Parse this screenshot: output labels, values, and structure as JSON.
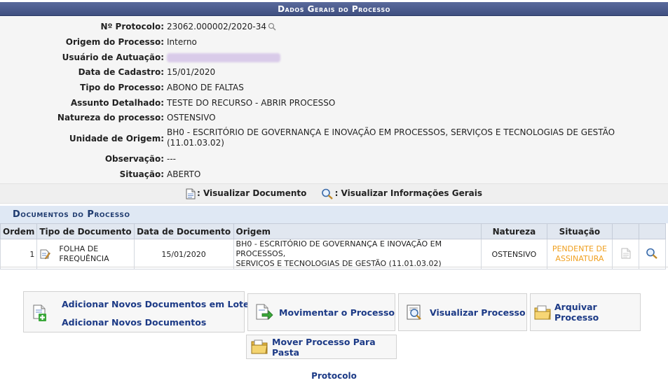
{
  "header": {
    "title": "Dados Gerais do Processo"
  },
  "general": [
    {
      "label": "Nº Protocolo:",
      "value": "23062.000002/2020-34"
    },
    {
      "label": "Origem do Processo:",
      "value": "Interno"
    },
    {
      "label": "Usuário de Autuação:",
      "value": ""
    },
    {
      "label": "Data de Cadastro:",
      "value": "15/01/2020"
    },
    {
      "label": "Tipo do Processo:",
      "value": "ABONO DE FALTAS"
    },
    {
      "label": "Assunto Detalhado:",
      "value": "TESTE DO RECURSO - ABRIR PROCESSO"
    },
    {
      "label": "Natureza do processo:",
      "value": "OSTENSIVO"
    },
    {
      "label": "Unidade de Origem:",
      "value": "BH0 - ESCRITÓRIO DE GOVERNANÇA E INOVAÇÃO EM PROCESSOS, SERVIÇOS E TECNOLOGIAS DE GESTÃO (11.01.03.02)"
    },
    {
      "label": "Observação:",
      "value": "---"
    },
    {
      "label": "Situação:",
      "value": "ABERTO"
    }
  ],
  "legend": {
    "view_document": ": Visualizar Documento",
    "view_info": ": Visualizar Informações Gerais"
  },
  "documents": {
    "title": "Documentos do Processo",
    "columns": [
      "Ordem",
      "Tipo de Documento",
      "Data de Documento",
      "Origem",
      "Natureza",
      "Situação"
    ],
    "rows": [
      {
        "ordem": "1",
        "tipo_line1": "FOLHA DE",
        "tipo_line2": "FREQUÊNCIA",
        "data": "15/01/2020",
        "origem_line1": "BH0 - ESCRITÓRIO DE GOVERNANÇA E INOVAÇÃO EM PROCESSOS,",
        "origem_line2": "SERVIÇOS E TECNOLOGIAS DE GESTÃO (11.01.03.02)",
        "natureza": "OSTENSIVO",
        "situacao_line1": "PENDENTE DE",
        "situacao_line2": "ASSINATURA"
      }
    ]
  },
  "actions": {
    "add_batch": "Adicionar Novos Documentos em Lote",
    "add_docs": "Adicionar Novos Documentos",
    "move": "Movimentar o Processo",
    "view": "Visualizar Processo",
    "archive": "Arquivar Processo",
    "move_folder": "Mover Processo Para Pasta"
  },
  "footer": {
    "link": "Protocolo"
  },
  "colors": {
    "header": "#3f4f80",
    "link": "#1c3a86",
    "pending": "#f0a020"
  }
}
